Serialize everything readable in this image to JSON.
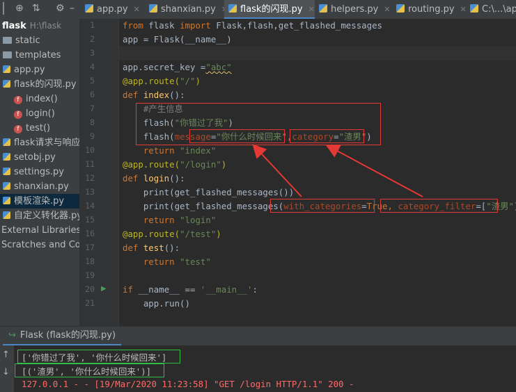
{
  "colors": {
    "accent": "#4a88c7",
    "annotation_red": "#e53935",
    "annotation_green": "#2fbf45",
    "keyword": "#cc7832",
    "string": "#6a8759",
    "decorator": "#bbb529",
    "function_name": "#ffc66d"
  },
  "toolbar": {
    "icons": [
      "crosshair-icon",
      "collapse-icon",
      "gear-icon",
      "minimize-icon"
    ]
  },
  "tabs": [
    {
      "label": "app.py",
      "active": false
    },
    {
      "label": "shanxian.py",
      "active": false
    },
    {
      "label": "flask的闪现.py",
      "active": true
    },
    {
      "label": "helpers.py",
      "active": false
    },
    {
      "label": "routing.py",
      "active": false
    },
    {
      "label": "C:\\...\\ap",
      "active": false
    }
  ],
  "project": {
    "name": "flask",
    "path": "H:\\flask"
  },
  "tree": [
    {
      "label": "static",
      "type": "folder"
    },
    {
      "label": "templates",
      "type": "folder"
    },
    {
      "label": "app.py",
      "type": "py"
    },
    {
      "label": "flask的闪现.py",
      "type": "py"
    },
    {
      "label": "index()",
      "type": "fn"
    },
    {
      "label": "login()",
      "type": "fn"
    },
    {
      "label": "test()",
      "type": "fn"
    },
    {
      "label": "flask请求与响应.py",
      "type": "py"
    },
    {
      "label": "setobj.py",
      "type": "py"
    },
    {
      "label": "settings.py",
      "type": "py"
    },
    {
      "label": "shanxian.py",
      "type": "py"
    },
    {
      "label": "模板渲染.py",
      "type": "py",
      "selected": true
    },
    {
      "label": "自定义转化器.py",
      "type": "py"
    },
    {
      "label": "External Libraries",
      "type": "lib"
    },
    {
      "label": "Scratches and Consoles",
      "type": "lib"
    }
  ],
  "line_numbers": [
    "1",
    "2",
    "3",
    "4",
    "5",
    "6",
    "7",
    "8",
    "9",
    "10",
    "11",
    "12",
    "13",
    "14",
    "15",
    "16",
    "17",
    "18",
    "19",
    "20",
    "21"
  ],
  "code": {
    "l1": {
      "kw_from": "from",
      "mod": " flask ",
      "kw_import": "import",
      "rest": " Flask,flash,get_flashed_messages"
    },
    "l2": {
      "text": "app = Flask(__name__)"
    },
    "l4": {
      "pre": "app.secret_key =",
      "str": "\"abc\""
    },
    "l5": {
      "dec": "@app.route(",
      "str": "\"/\"",
      "close": ")"
    },
    "l6": {
      "kw": "def ",
      "fn": "index",
      "rest": "():"
    },
    "l7": {
      "text": "    #产生信息"
    },
    "l8": {
      "pre": "    flash(",
      "str": "\"你错过了我\"",
      "close": ")"
    },
    "l9": {
      "pre": "    flash(",
      "p1": "message",
      "eq1": "=",
      "s1": "\"你什么时候回来\"",
      "comma": ",",
      "p2": "category",
      "eq2": "=",
      "s2": "\"渣男\"",
      "close": ")"
    },
    "l10": {
      "kw": "    return ",
      "str": "\"index\""
    },
    "l11": {
      "dec": "@app.route(",
      "str": "\"/login\"",
      "close": ")"
    },
    "l12": {
      "kw": "def ",
      "fn": "login",
      "rest": "():"
    },
    "l13": {
      "text": "    print(get_flashed_messages())"
    },
    "l14": {
      "pre": "    print(get_flashed_messages(",
      "p1": "with_categories",
      "eq1": "=",
      "kw1": "True",
      "comma": ", ",
      "p2": "category_filter",
      "eq2": "=[",
      "s2": "\"渣男\"",
      "close": "]))"
    },
    "l15": {
      "kw": "    return ",
      "str": "\"login\""
    },
    "l16": {
      "dec": "@app.route(",
      "str": "\"/test\"",
      "close": ")"
    },
    "l17": {
      "kw": "def ",
      "fn": "test",
      "rest": "():"
    },
    "l18": {
      "kw": "    return ",
      "str": "\"test\""
    },
    "l20": {
      "kw": "if ",
      "pre": "__name__ == ",
      "str": "'__main__'",
      "close": ":"
    },
    "l21": {
      "text": "    app.run()"
    }
  },
  "run_panel": {
    "tab_label": "Flask (flask的闪现.py)"
  },
  "console": {
    "lines": [
      "['你错过了我', '你什么时候回来']",
      "[('渣男', '你什么时候回来')]",
      "127.0.0.1 - - [19/Mar/2020 11:23:58] \"GET /login HTTP/1.1\" 200 -"
    ],
    "side_icons": [
      "up-arrow-icon",
      "down-arrow-icon"
    ]
  }
}
